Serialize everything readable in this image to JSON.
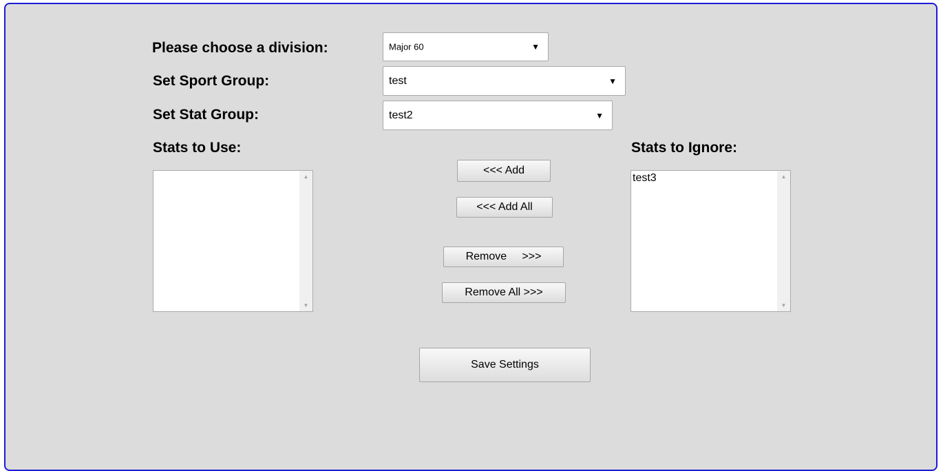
{
  "form": {
    "division_label": "Please choose a division:",
    "division_value": "Major 60",
    "sport_group_label": "Set Sport Group:",
    "sport_group_value": "test",
    "stat_group_label": "Set Stat Group:",
    "stat_group_value": "test2",
    "stats_use_label": "Stats to Use:",
    "stats_ignore_label": "Stats to Ignore:",
    "stats_use_items": [],
    "stats_ignore_items": [
      "test3"
    ]
  },
  "buttons": {
    "add": "<<< Add",
    "add_all": "<<< Add All",
    "remove": "Remove     >>>",
    "remove_all": "Remove All >>>",
    "save": "Save Settings"
  },
  "icons": {
    "dropdown_arrow": "▼",
    "scroll_up": "▲",
    "scroll_down": "▼"
  },
  "colors": {
    "panel_background": "#dcdcdc",
    "panel_border": "#1a1ad6"
  }
}
